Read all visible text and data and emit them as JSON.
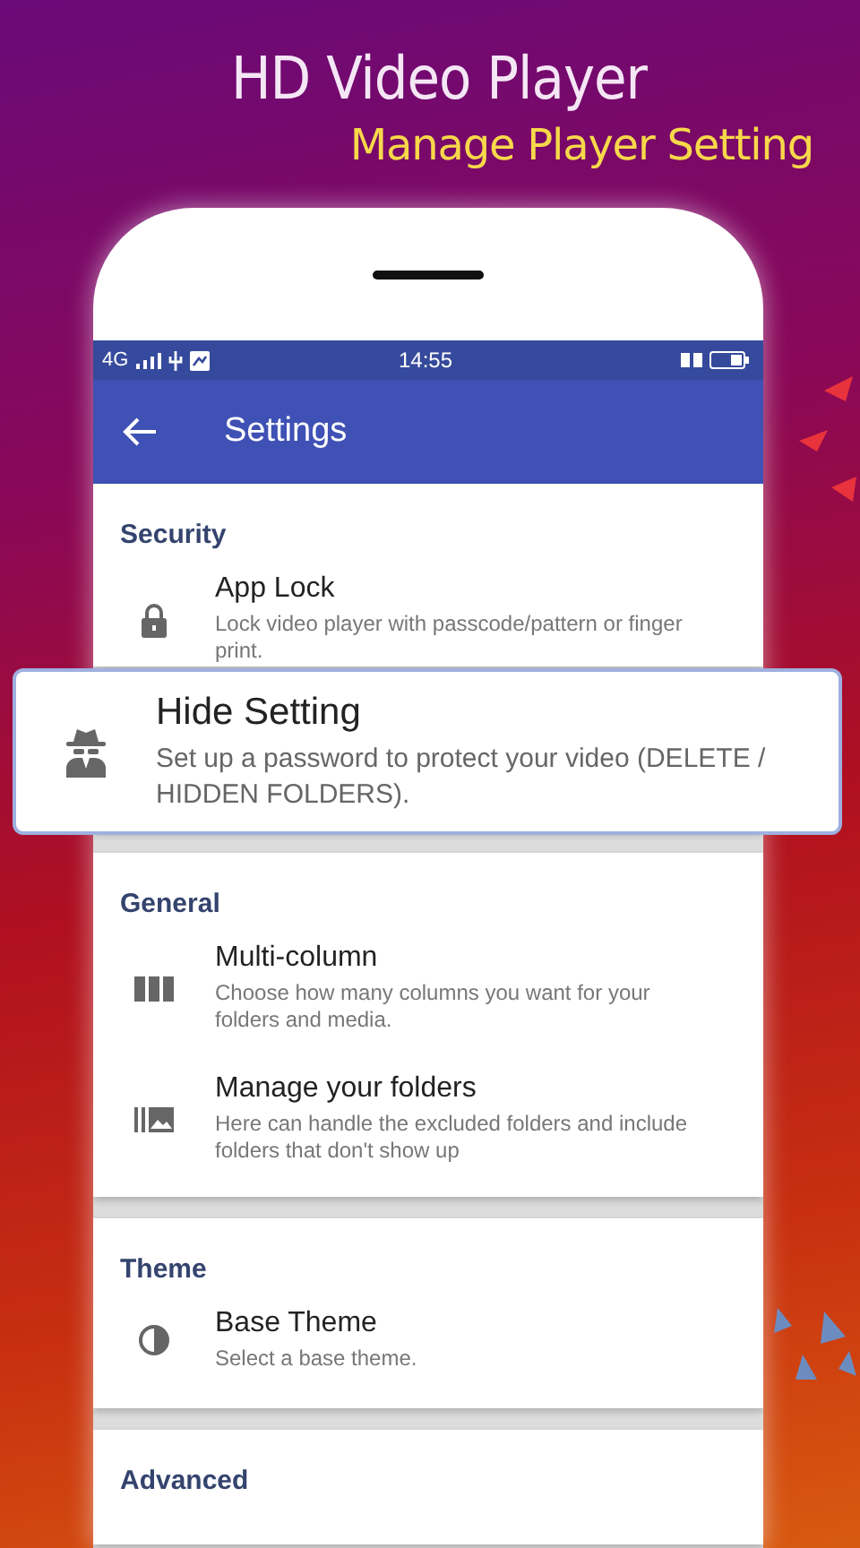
{
  "promo": {
    "title": "HD Video Player",
    "subtitle": "Manage Player Setting"
  },
  "status_bar": {
    "network": "4G",
    "time": "14:55"
  },
  "app_bar": {
    "title": "Settings"
  },
  "sections": [
    {
      "title": "Security",
      "items": [
        {
          "kind": "lock",
          "title": "App Lock",
          "description": "Lock video player with passcode/pattern or finger print."
        }
      ]
    },
    {
      "title": "General",
      "items": [
        {
          "kind": "columns",
          "title": "Multi-column",
          "description": "Choose how many columns you want for your folders and media."
        },
        {
          "kind": "folders",
          "title": "Manage your folders",
          "description": "Here can handle the excluded folders and include folders that don't show up"
        }
      ]
    },
    {
      "title": "Theme",
      "items": [
        {
          "kind": "contrast",
          "title": "Base Theme",
          "description": "Select a base theme."
        }
      ]
    },
    {
      "title": "Advanced"
    }
  ],
  "highlight": {
    "kind": "spy",
    "title": "Hide Setting",
    "description": "Set up a password to protect your video (DELETE / HIDDEN FOLDERS)."
  }
}
